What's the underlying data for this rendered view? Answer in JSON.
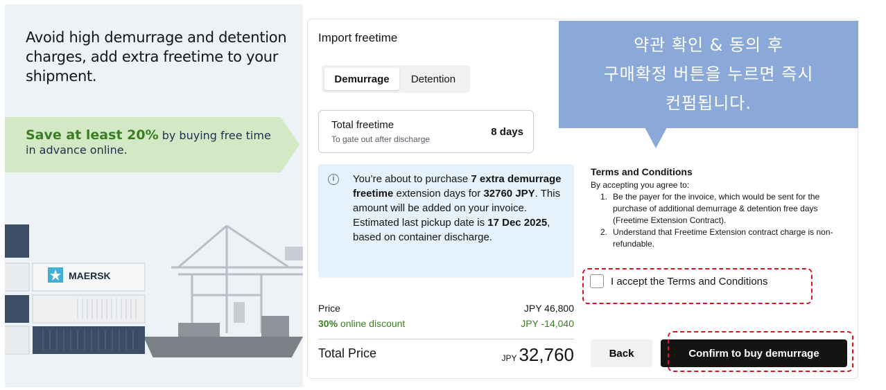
{
  "hero": {
    "heading": "Avoid high demurrage and detention charges, add extra freetime to your shipment.",
    "banner_strong": "Save at least 20%",
    "banner_rest": " by buying free time in advance online."
  },
  "scene": {
    "logo_text": "MAERSK"
  },
  "card": {
    "title": "Import freetime",
    "tabs": [
      {
        "label": "Demurrage",
        "active": true
      },
      {
        "label": "Detention",
        "active": false
      }
    ],
    "freetime": {
      "label": "Total freetime",
      "sub": "To gate out after discharge",
      "value": "8 days"
    },
    "info": {
      "icon": "info-icon",
      "t1": "You’re about to purchase ",
      "b1": "7 extra demurrage freetime",
      "t2": " extension days for ",
      "b2": "32760 JPY",
      "t3": ". This amount will be added on your invoice. Estimated last pickup date is ",
      "b3": "17 Dec 2025",
      "t4": ", based on container discharge."
    },
    "price": {
      "label": "Price",
      "value": "JPY 46,800",
      "discount_pct": "30%",
      "discount_label": " online discount",
      "discount_value": "JPY -14,040",
      "total_label": "Total Price",
      "total_currency": "JPY",
      "total_value": "32,760"
    }
  },
  "tooltip": {
    "line1": "약관 확인 & 동의 후",
    "line2": "구매확정 버튼을 누르면 즉시",
    "line3": "컨펌됩니다."
  },
  "terms": {
    "title": "Terms and Conditions",
    "intro": "By accepting you agree to:",
    "items": [
      {
        "num": "1.",
        "text": "Be the payer for the invoice, which would be sent for the purchase of additional demurrage & detention free days (Freetime Extension Contract)."
      },
      {
        "num": "2.",
        "text": "Understand that Freetime Extension contract charge is non-refundable."
      }
    ],
    "accept_label": "I accept the Terms and Conditions"
  },
  "actions": {
    "back": "Back",
    "confirm": "Confirm to buy demurrage"
  },
  "colors": {
    "banner_green": "#d3e9c6",
    "discount_green": "#3b7d23",
    "info_blue": "#e6f2fb",
    "tooltip_blue": "#8aa9d8",
    "highlight_red": "#e01020",
    "maersk_blue": "#42b0d5"
  }
}
